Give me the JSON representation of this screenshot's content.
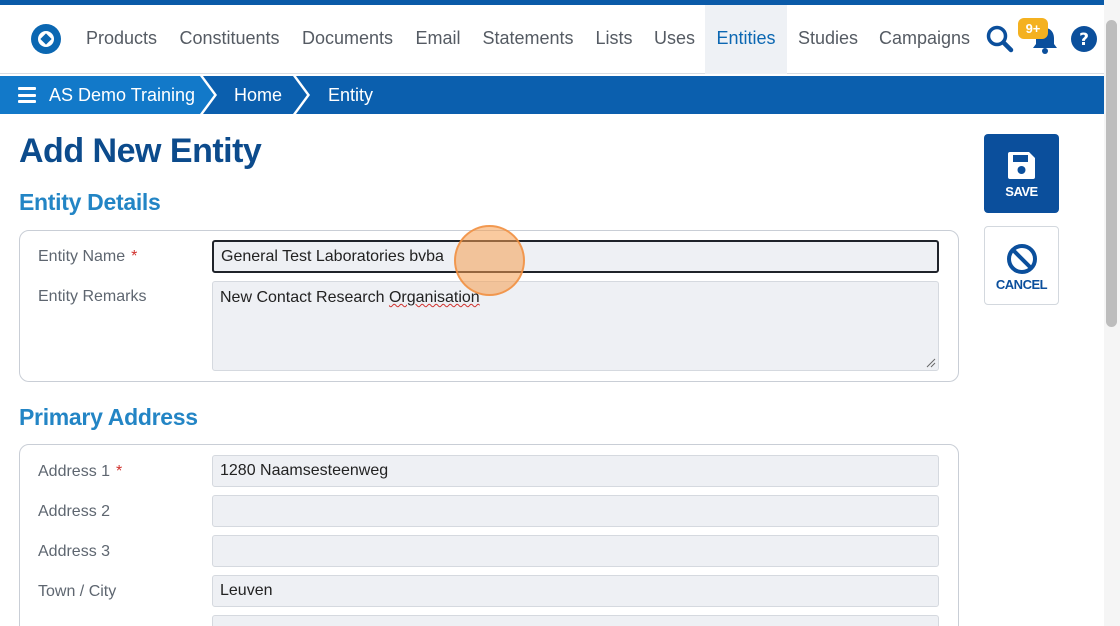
{
  "nav": {
    "items": [
      {
        "label": "Products",
        "active": false
      },
      {
        "label": "Constituents",
        "active": false
      },
      {
        "label": "Documents",
        "active": false
      },
      {
        "label": "Email",
        "active": false
      },
      {
        "label": "Statements",
        "active": false
      },
      {
        "label": "Lists",
        "active": false
      },
      {
        "label": "Uses",
        "active": false
      },
      {
        "label": "Entities",
        "active": true
      },
      {
        "label": "Studies",
        "active": false
      },
      {
        "label": "Campaigns",
        "active": false
      }
    ],
    "notification_badge": "9+",
    "icons": [
      "logo-icon",
      "search-icon",
      "bell-icon",
      "help-icon"
    ]
  },
  "breadcrumb": {
    "items": [
      "AS Demo Training",
      "Home",
      "Entity"
    ]
  },
  "page": {
    "title": "Add New Entity"
  },
  "entity_details": {
    "section_title": "Entity Details",
    "name_label": "Entity Name",
    "name_value": "General Test Laboratories bvba",
    "remarks_label": "Entity Remarks",
    "remarks_value": "New Contact Research Organisation",
    "required_marker": "*"
  },
  "primary_address": {
    "section_title": "Primary Address",
    "fields": [
      {
        "label": "Address 1",
        "value": "1280 Naamsesteenweg",
        "required": true
      },
      {
        "label": "Address 2",
        "value": "",
        "required": false
      },
      {
        "label": "Address 3",
        "value": "",
        "required": false
      },
      {
        "label": "Town / City",
        "value": "Leuven",
        "required": false
      }
    ]
  },
  "actions": {
    "save_label": "SAVE",
    "cancel_label": "CANCEL"
  },
  "colors": {
    "brand_blue": "#0b5fae",
    "title_blue": "#0c4b8c",
    "section_blue": "#2385c5",
    "badge_orange": "#f4b120",
    "required_red": "#d0312d"
  }
}
